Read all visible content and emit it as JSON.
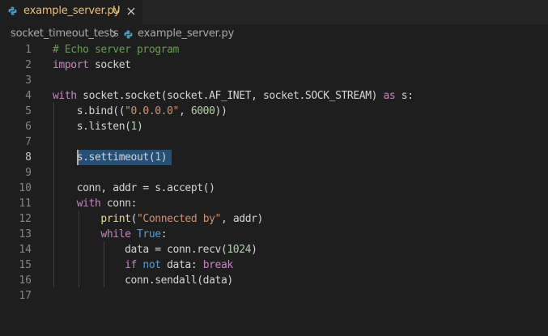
{
  "tab": {
    "label": "example_server.py",
    "status": "U",
    "icon": "python-file-icon",
    "label_color": "#e5c07b"
  },
  "breadcrumb": {
    "folder": "socket_timeout_tests",
    "file": "example_server.py"
  },
  "editor": {
    "active_line": 8,
    "line_numbers": [
      "1",
      "2",
      "3",
      "4",
      "5",
      "6",
      "7",
      "8",
      "9",
      "10",
      "11",
      "12",
      "13",
      "14",
      "15",
      "16",
      "17"
    ],
    "lines": [
      [
        [
          "cm",
          "# Echo server program"
        ]
      ],
      [
        [
          "kw",
          "import"
        ],
        [
          "pl",
          " socket"
        ]
      ],
      [],
      [
        [
          "kw",
          "with"
        ],
        [
          "pl",
          " socket.socket(socket.AF_INET, socket.SOCK_STREAM) "
        ],
        [
          "kw",
          "as"
        ],
        [
          "pl",
          " s:"
        ]
      ],
      [
        [
          "pl",
          "    s.bind(("
        ],
        [
          "str",
          "\"0.0.0.0\""
        ],
        [
          "pl",
          ", "
        ],
        [
          "num",
          "6000"
        ],
        [
          "pl",
          "))"
        ]
      ],
      [
        [
          "pl",
          "    s.listen("
        ],
        [
          "num",
          "1"
        ],
        [
          "pl",
          ")"
        ]
      ],
      [],
      [
        [
          "pl",
          "    s.settimeout("
        ],
        [
          "num",
          "1"
        ],
        [
          "pl",
          ")"
        ]
      ],
      [],
      [
        [
          "pl",
          "    conn, addr = s.accept()"
        ]
      ],
      [
        [
          "pl",
          "    "
        ],
        [
          "kw",
          "with"
        ],
        [
          "pl",
          " conn:"
        ]
      ],
      [
        [
          "pl",
          "        "
        ],
        [
          "fn",
          "print"
        ],
        [
          "pl",
          "("
        ],
        [
          "str",
          "\"Connected by\""
        ],
        [
          "pl",
          ", addr)"
        ]
      ],
      [
        [
          "pl",
          "        "
        ],
        [
          "kw",
          "while"
        ],
        [
          "pl",
          " "
        ],
        [
          "kw2",
          "True"
        ],
        [
          "pl",
          ":"
        ]
      ],
      [
        [
          "pl",
          "            data = conn.recv("
        ],
        [
          "num",
          "1024"
        ],
        [
          "pl",
          ")"
        ]
      ],
      [
        [
          "pl",
          "            "
        ],
        [
          "kw",
          "if"
        ],
        [
          "pl",
          " "
        ],
        [
          "kw2",
          "not"
        ],
        [
          "pl",
          " data: "
        ],
        [
          "kw",
          "break"
        ]
      ],
      [
        [
          "pl",
          "            conn.sendall(data)"
        ]
      ],
      []
    ],
    "colors": {
      "background": "#1e1e1e",
      "selection": "#264f78",
      "keyword": "#c586c0",
      "constant": "#569cd6",
      "string": "#ce9178",
      "number": "#b5cea8",
      "comment": "#6a9955",
      "function": "#dcdcaa"
    }
  }
}
